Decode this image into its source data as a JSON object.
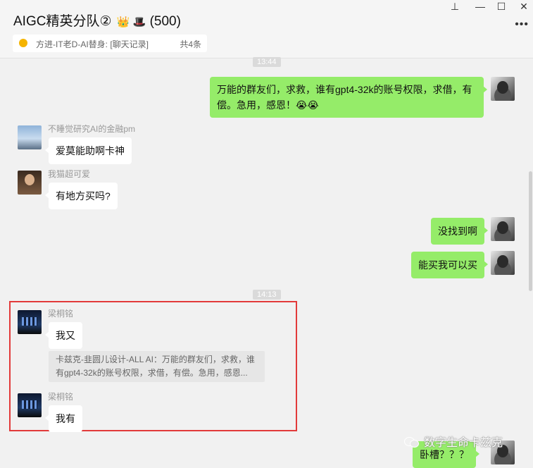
{
  "window": {
    "title": "AIGC精英分队②",
    "title_emojis": "👑 🎩",
    "member_count": "(500)",
    "controls": {
      "pin": "⊥",
      "minimize": "—",
      "maximize": "☐",
      "close": "✕"
    },
    "more_icon": "more-dots-icon"
  },
  "pinned": {
    "icon": "sun-icon",
    "text": "方进-IT老D-AI替身: [聊天记录]",
    "count": "共4条"
  },
  "timestamps": {
    "t1": "13:44",
    "t2": "14:13"
  },
  "messages": {
    "m1": {
      "text": "万能的群友们，求救，谁有gpt4-32k的账号权限，求借，有偿。急用，感恩！😭😭"
    },
    "m2": {
      "sender": "不睡觉研究AI的金融pm",
      "text": "爱莫能助啊卡神"
    },
    "m3": {
      "sender": "我猫超可爱",
      "text": "有地方买吗?"
    },
    "m4": {
      "text": "没找到啊"
    },
    "m5": {
      "text": "能买我可以买"
    },
    "m6": {
      "sender": "梁桐铭",
      "text": "我又",
      "quote": "卡兹克-韭圆儿设计-ALL AI：万能的群友们，求救，谁有gpt4-32k的账号权限，求借，有偿。急用，感恩..."
    },
    "m7": {
      "sender": "梁桐铭",
      "text": "我有"
    },
    "m8": {
      "text": "卧槽？？？"
    }
  },
  "watermark": "数字生命卡兹克",
  "colors": {
    "self_bubble": "#95ec69",
    "other_bubble": "#ffffff",
    "highlight_box": "#e23a3a"
  }
}
